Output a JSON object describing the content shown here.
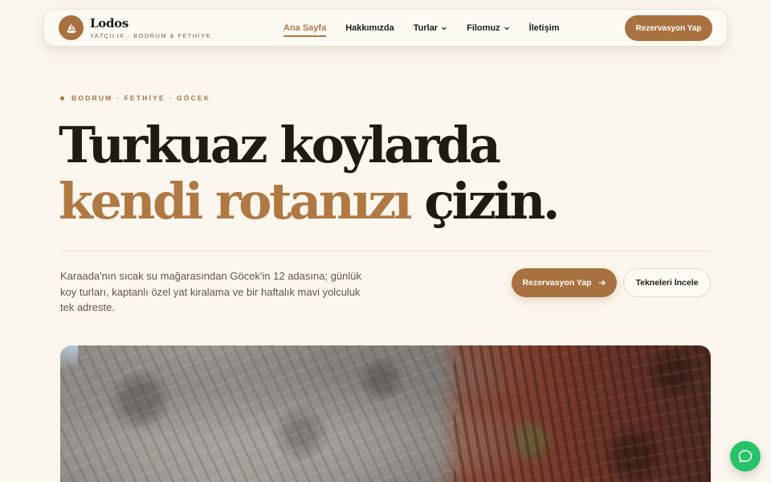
{
  "brand": {
    "name": "Lodos",
    "tagline": "YATÇILIK · BODRUM & FETHİYE",
    "logo_icon": "sailboat-icon"
  },
  "nav": {
    "items": [
      {
        "label": "Ana Sayfa",
        "active": true
      },
      {
        "label": "Hakkımızda",
        "active": false
      },
      {
        "label": "Turlar",
        "active": false,
        "dropdown": true
      },
      {
        "label": "Filomuz",
        "active": false,
        "dropdown": true
      },
      {
        "label": "İletişim",
        "active": false
      }
    ],
    "cta_label": "Rezervasyon Yap"
  },
  "hero": {
    "eyebrow": "BODRUM · FETHİYE · GÖCEK",
    "headline_line1": "Turkuaz koylarda",
    "headline_accent": "kendi rotanızı",
    "headline_end": " çizin.",
    "lead": "Karaada'nın sıcak su mağarasından Göcek'in 12 adasına; günlük koy turları, kaptanlı özel yat kiralama ve bir haftalık mavi yolculuk tek adreste.",
    "primary_cta": "Rezervasyon Yap",
    "secondary_cta": "Tekneleri İncele"
  },
  "colors": {
    "accent": "#a8713f",
    "background": "#fbf7ef",
    "text": "#1f1a14",
    "chat": "#27c368"
  },
  "icons": {
    "primary_cta_icon": "arrow-right-icon",
    "dropdown_icon": "chevron-down-icon",
    "chat_icon": "chat-bubble-icon"
  }
}
